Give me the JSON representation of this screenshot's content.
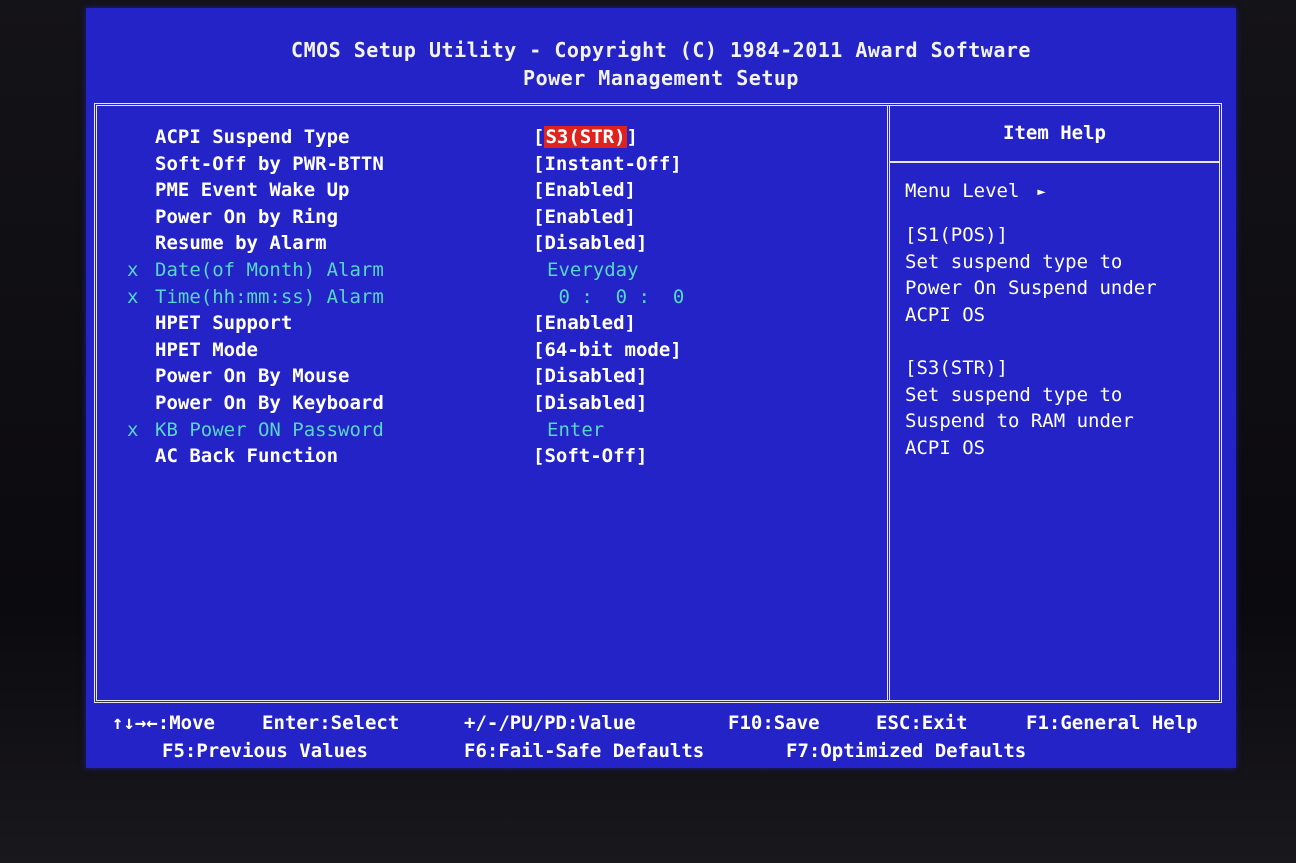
{
  "header": {
    "title": "CMOS Setup Utility - Copyright (C) 1984-2011 Award Software",
    "subtitle": "Power Management Setup"
  },
  "settings": [
    {
      "label": "ACPI Suspend Type",
      "value_open": "[",
      "value_sel": "S3(STR)",
      "value_close": "]",
      "prefix": "",
      "disabled": false,
      "selected": true
    },
    {
      "label": "Soft-Off by PWR-BTTN",
      "value": "[Instant-Off]",
      "prefix": "",
      "disabled": false
    },
    {
      "label": "PME Event Wake Up",
      "value": "[Enabled]",
      "prefix": "",
      "disabled": false
    },
    {
      "label": "Power On by Ring",
      "value": "[Enabled]",
      "prefix": "",
      "disabled": false
    },
    {
      "label": "Resume by Alarm",
      "value": "[Disabled]",
      "prefix": "",
      "disabled": false
    },
    {
      "label": "Date(of Month) Alarm",
      "value": "Everyday",
      "prefix": "x",
      "disabled": true
    },
    {
      "label": "Time(hh:mm:ss) Alarm",
      "value": " 0 :  0 :  0",
      "prefix": "x",
      "disabled": true
    },
    {
      "label": "HPET Support",
      "value": "[Enabled]",
      "prefix": "",
      "disabled": false
    },
    {
      "label": "HPET Mode",
      "value": "[64-bit mode]",
      "prefix": "",
      "disabled": false
    },
    {
      "label": "Power On By Mouse",
      "value": "[Disabled]",
      "prefix": "",
      "disabled": false
    },
    {
      "label": "Power On By Keyboard",
      "value": "[Disabled]",
      "prefix": "",
      "disabled": false
    },
    {
      "label": "KB Power ON Password",
      "value": "Enter",
      "prefix": "x",
      "disabled": true
    },
    {
      "label": "AC Back Function",
      "value": "[Soft-Off]",
      "prefix": "",
      "disabled": false
    }
  ],
  "help": {
    "title": "Item Help",
    "menu_level": "Menu Level",
    "lines": [
      "[S1(POS)]",
      "Set suspend type to",
      "Power On Suspend under",
      "ACPI OS",
      "",
      "[S3(STR)]",
      "Set suspend type to",
      "Suspend to RAM under",
      "ACPI OS"
    ]
  },
  "footer": {
    "move": "↑↓→←:Move",
    "select": "Enter:Select",
    "value": "+/-/PU/PD:Value",
    "save": "F10:Save",
    "exit": "ESC:Exit",
    "general_help": "F1:General Help",
    "previous": "F5:Previous Values",
    "failsafe": "F6:Fail-Safe Defaults",
    "optimized": "F7:Optimized Defaults"
  },
  "colors": {
    "background": "#2323c8",
    "text": "#ffffff",
    "disabled_text": "#56d7c8",
    "selection": "#e0221e"
  }
}
